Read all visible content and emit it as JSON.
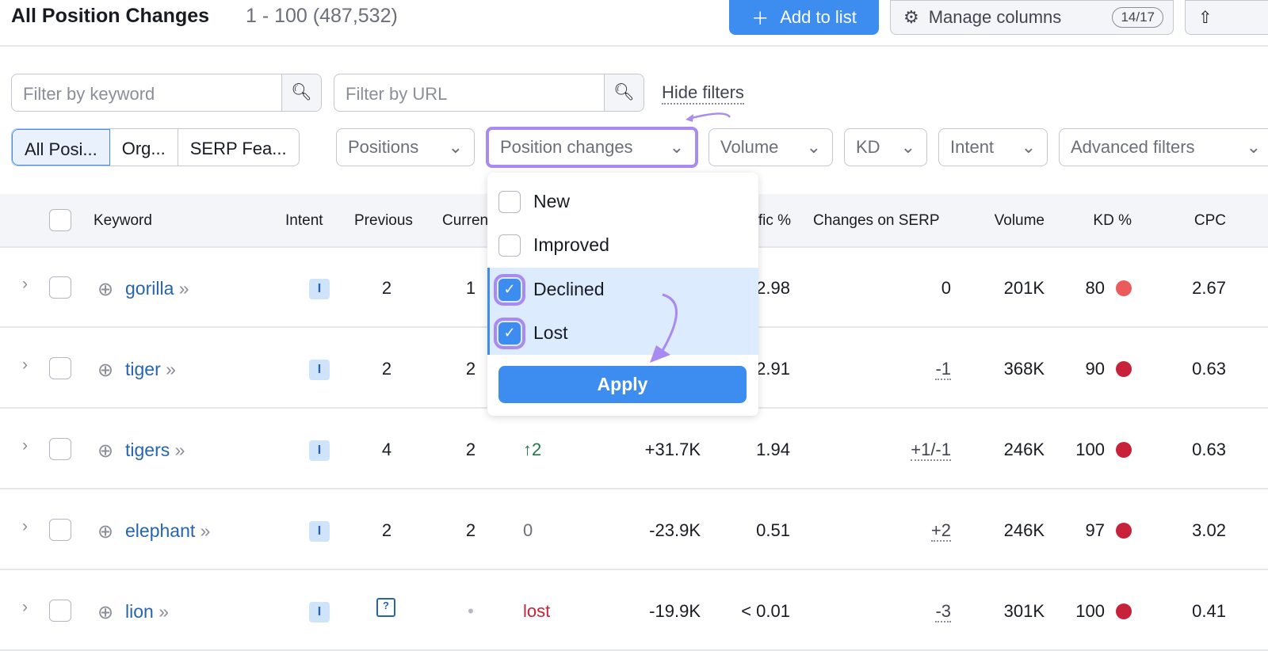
{
  "header": {
    "title": "All Position Changes",
    "count": "1 - 100 (487,532)",
    "add_to_list": "Add to list",
    "manage_columns": "Manage columns",
    "columns_badge": "14/17"
  },
  "filters": {
    "keyword_placeholder": "Filter by keyword",
    "url_placeholder": "Filter by URL",
    "hide_filters": "Hide filters",
    "segments": [
      "All Posi...",
      "Org...",
      "SERP Fea..."
    ],
    "dropdowns": [
      "Positions",
      "Position changes",
      "Volume",
      "KD",
      "Intent",
      "Advanced filters"
    ]
  },
  "table": {
    "headers": {
      "keyword": "Keyword",
      "intent": "Intent",
      "previous": "Previous",
      "current": "Current",
      "traffic_pct": "Traffic %",
      "serp": "Changes on SERP",
      "volume": "Volume",
      "kd": "KD %",
      "cpc": "CPC"
    },
    "rows": [
      {
        "keyword": "gorilla",
        "intent": "I",
        "previous": "2",
        "current": "1",
        "pos_change": "",
        "traffic": "",
        "traffic_pct": "2.98",
        "serp": "0",
        "volume": "201K",
        "kd": "80",
        "kd_color": "#ec5b5b",
        "cpc": "2.67"
      },
      {
        "keyword": "tiger",
        "intent": "I",
        "previous": "2",
        "current": "2",
        "pos_change": "",
        "traffic": "",
        "traffic_pct": "2.91",
        "serp": "-1",
        "volume": "368K",
        "kd": "90",
        "kd_color": "#c8213a",
        "cpc": "0.63"
      },
      {
        "keyword": "tigers",
        "intent": "I",
        "previous": "4",
        "current": "2",
        "pos_change": "↑2",
        "traffic": "+31.7K",
        "traffic_pct": "1.94",
        "serp": "+1/-1",
        "volume": "246K",
        "kd": "100",
        "kd_color": "#c8213a",
        "cpc": "0.63"
      },
      {
        "keyword": "elephant",
        "intent": "I",
        "previous": "2",
        "current": "2",
        "pos_change": "0",
        "traffic": "-23.9K",
        "traffic_pct": "0.51",
        "serp": "+2",
        "volume": "246K",
        "kd": "97",
        "kd_color": "#c8213a",
        "cpc": "3.02"
      },
      {
        "keyword": "lion",
        "intent": "I",
        "previous": "?",
        "current": "•",
        "pos_change": "lost",
        "traffic": "-19.9K",
        "traffic_pct": "< 0.01",
        "serp": "-3",
        "volume": "301K",
        "kd": "100",
        "kd_color": "#c8213a",
        "cpc": "0.41"
      }
    ]
  },
  "menu": {
    "items": [
      {
        "label": "New",
        "checked": false
      },
      {
        "label": "Improved",
        "checked": false
      },
      {
        "label": "Declined",
        "checked": true
      },
      {
        "label": "Lost",
        "checked": true
      }
    ],
    "apply": "Apply"
  },
  "colors": {
    "accent": "#3d8df0",
    "highlight": "#a88af0",
    "up": "#1e7a46",
    "lost": "#c8213a"
  }
}
